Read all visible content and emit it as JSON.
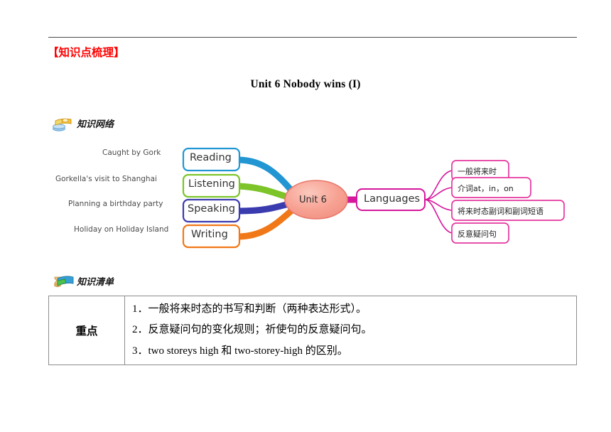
{
  "header": {
    "section_heading": "【知识点梳理】",
    "doc_title": "Unit 6 Nobody wins (I)"
  },
  "sections": [
    {
      "icon": "books-stack-icon",
      "label": "知识网络"
    },
    {
      "icon": "books-hourglass-icon",
      "label": "知识清单"
    }
  ],
  "mindmap": {
    "center": {
      "label": "Unit 6",
      "fill": "#f8a898",
      "stroke": "#e8776a"
    },
    "branches": [
      {
        "node": "Reading",
        "leaf": "Caught by Gork",
        "color": "#2196d3"
      },
      {
        "node": "Listening",
        "leaf": "Gorkella's visit to Shanghai",
        "color": "#7cc428"
      },
      {
        "node": "Speaking",
        "leaf": "Planning a birthday party",
        "color": "#3b3bb0"
      },
      {
        "node": "Writing",
        "leaf": "Holiday on Holiday Island",
        "color": "#f07818"
      }
    ],
    "languages": {
      "node": "Languages",
      "color": "#d6179c",
      "items": [
        "一般将来时",
        "介词at，in，on",
        "将来时态副词和副词短语",
        "反意疑问句"
      ]
    }
  },
  "table": {
    "rows": [
      {
        "key": "重点",
        "lines": [
          "1．一般将来时态的书写和判断（两种表达形式）。",
          "2．反意疑问句的变化规则；祈使句的反意疑问句。",
          "3．two storeys high 和 two-storey-high 的区别。"
        ]
      }
    ]
  }
}
